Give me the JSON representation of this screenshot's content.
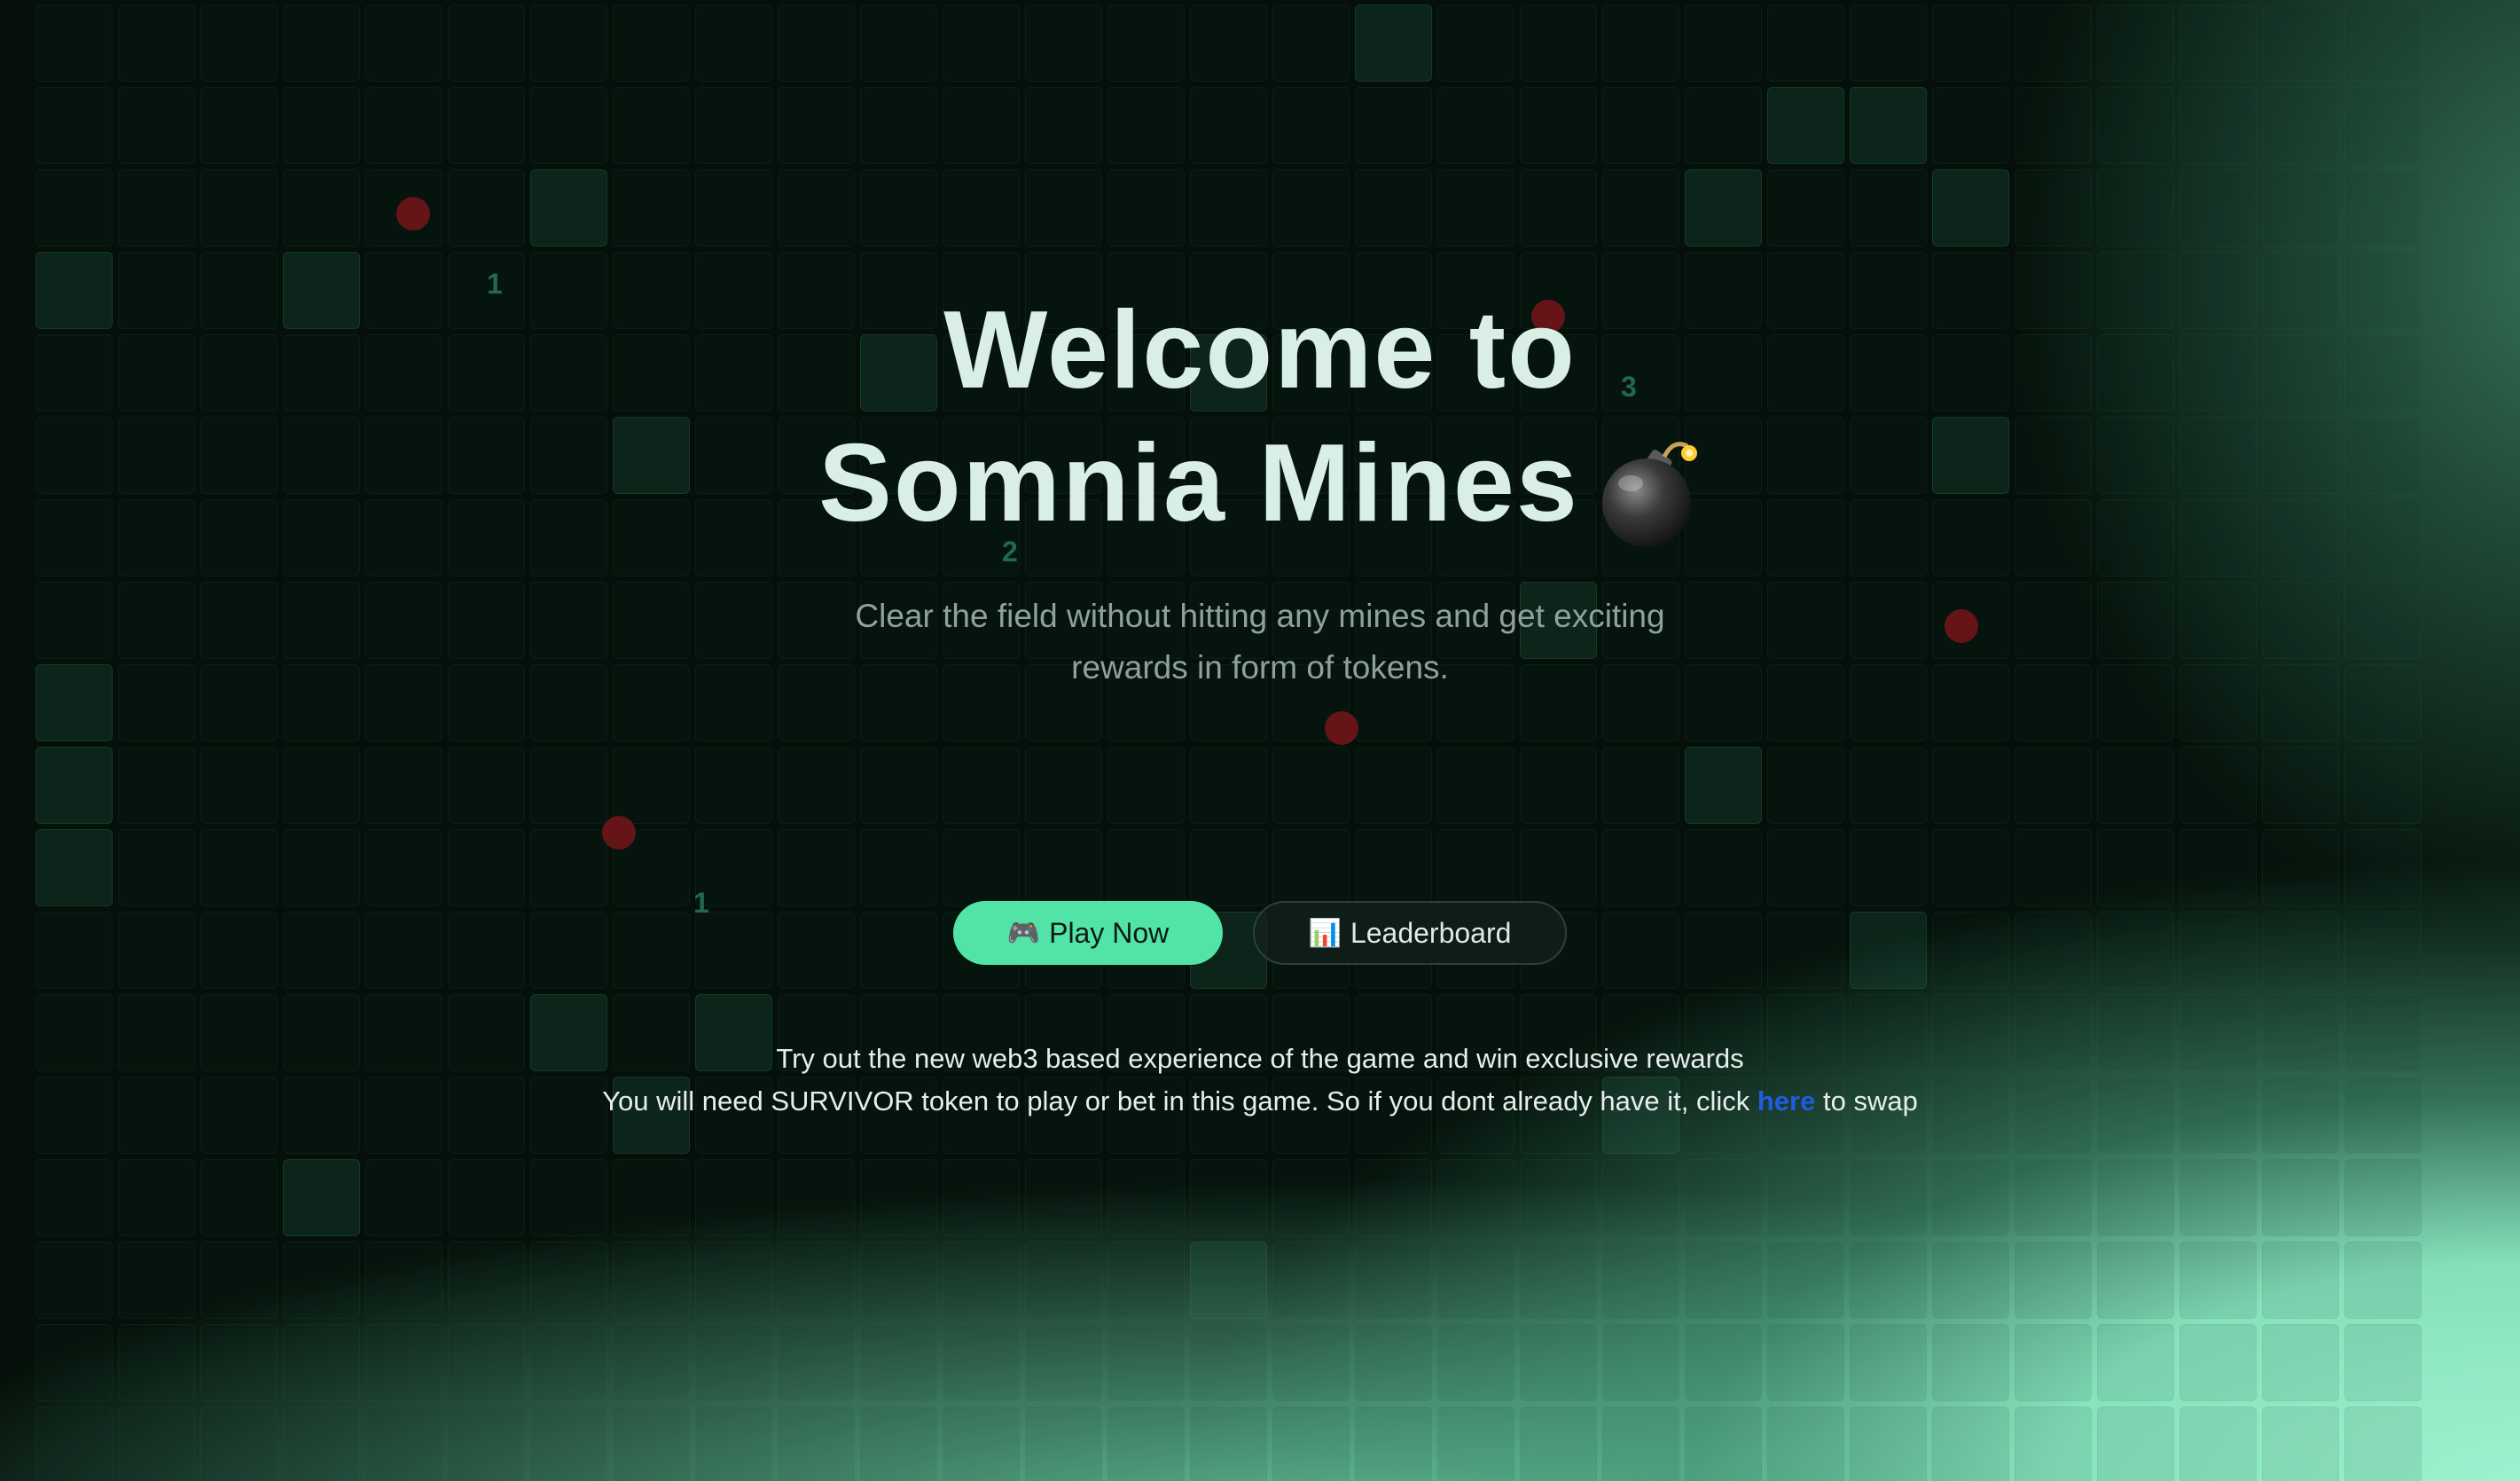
{
  "hero": {
    "title_line1": "Welcome to",
    "title_line2": "Somnia Mines",
    "title_icon": "bomb-icon",
    "subtitle": "Clear the field without hitting any mines and get exciting rewards in form of tokens."
  },
  "actions": {
    "play_icon": "🎮",
    "play_label": "Play Now",
    "leaderboard_icon": "📊",
    "leaderboard_label": "Leaderboard"
  },
  "footer": {
    "line1": "Try out the new web3 based experience of the game and win exclusive rewards",
    "line2_before": "You will need SURVIVOR token to play or bet in this game. So if you dont already have it, click ",
    "link_label": "here",
    "line2_after": " to swap"
  },
  "background": {
    "numbers": [
      "1",
      "3",
      "2",
      "1"
    ]
  },
  "colors": {
    "accent": "#52e3a7",
    "link": "#1f5de0",
    "mine": "#6a1519",
    "background": "#041009"
  }
}
